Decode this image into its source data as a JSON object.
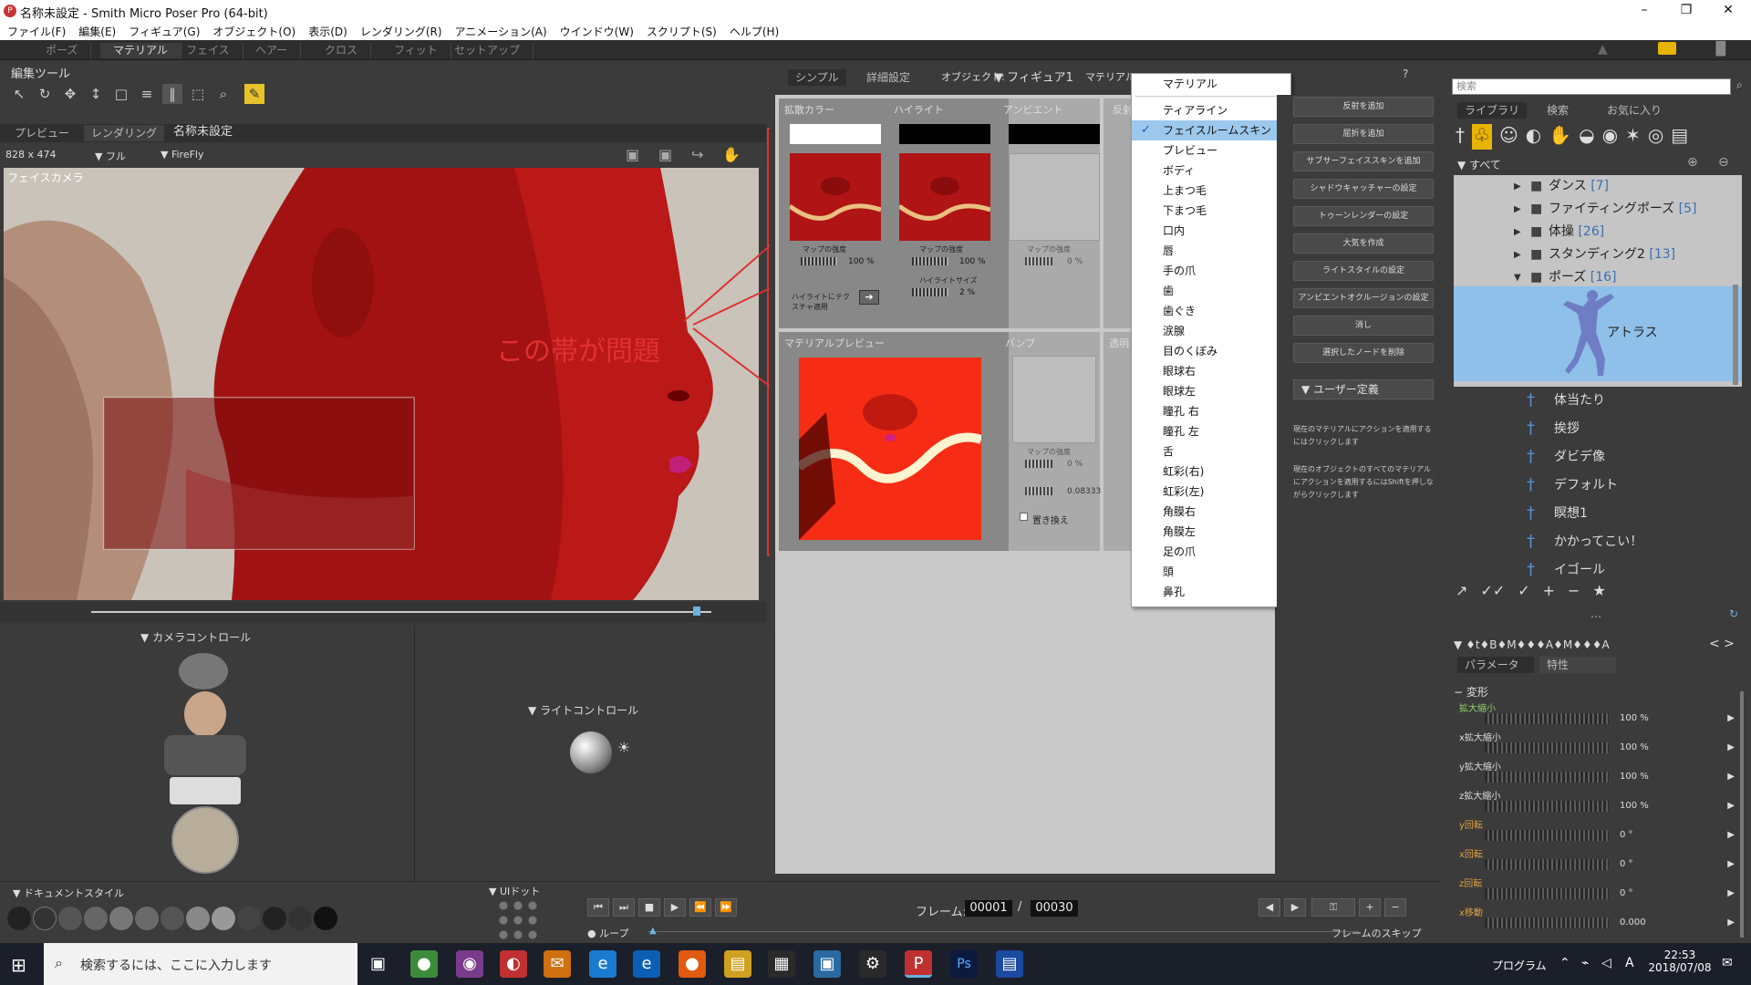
{
  "window": {
    "title": "名称未設定 - Smith Micro Poser Pro  (64-bit)",
    "controls": [
      "minimize-icon",
      "restore-icon",
      "close-icon"
    ]
  },
  "menubar": [
    "ファイル(F)",
    "編集(E)",
    "フィギュア(G)",
    "オブジェクト(O)",
    "表示(D)",
    "レンダリング(R)",
    "アニメーション(A)",
    "ウインドウ(W)",
    "スクリプト(S)",
    "ヘルプ(H)"
  ],
  "modes": [
    "ポーズ",
    "マテリアル",
    "フェイス",
    "ヘアー",
    "クロス",
    "フィット",
    "セットアップ"
  ],
  "active_mode": "マテリアル",
  "edit_tools": {
    "title": "編集ツール"
  },
  "viewport": {
    "tabs": [
      "プレビュー",
      "レンダリング"
    ],
    "doc_title": "名称未設定",
    "size": "828 x 474",
    "display": "フル",
    "renderer": "FireFly",
    "camera": "フェイスカメラ"
  },
  "annotation": {
    "text": "この帯が問題",
    "color": "#e03030"
  },
  "material_room": {
    "tabs": [
      "シンプル",
      "詳細設定"
    ],
    "object_label": "オブジェクト:",
    "object_value": "フィギュア1",
    "material_label": "マテリアル:",
    "columns": {
      "diffuse": "拡散カラー",
      "highlight": "ハイライト",
      "ambient": "アンビエント",
      "reflection": "反射",
      "bump": "バンプ",
      "transparency": "透明"
    },
    "map_strength_label": "マップの強度",
    "diffuse_strength": "100 %",
    "highlight_strength": "100 %",
    "ambient_strength": "0 %",
    "highlight_size_label": "ハイライトサイズ",
    "highlight_size": "2 %",
    "apply_texture": "ハイライトにテクスチャ適用",
    "preview_label": "マテリアルプレビュー",
    "bump_strength": "0 %",
    "bump_amount": "0.08333",
    "replace_label": "置き換え"
  },
  "material_dropdown": {
    "header": "マテリアル",
    "items": [
      "ティアライン",
      "フェイスルームスキン",
      "プレビュー",
      "ボディ",
      "上まつ毛",
      "下まつ毛",
      "口内",
      "唇",
      "手の爪",
      "歯",
      "歯ぐき",
      "涙腺",
      "目のくぼみ",
      "眼球右",
      "眼球左",
      "瞳孔 右",
      "瞳孔 左",
      "舌",
      "虹彩(右)",
      "虹彩(左)",
      "角膜右",
      "角膜左",
      "足の爪",
      "頭",
      "鼻孔"
    ],
    "selected": "フェイスルームスキン"
  },
  "wizards": [
    "反射を追加",
    "屈折を追加",
    "サブサーフェイススキンを追加",
    "シャドウキャッチャーの設定",
    "トゥーンレンダーの設定",
    "大気を作成",
    "ライトスタイルの設定",
    "アンビエントオクルージョンの設定",
    "消し",
    "選択したノードを削除"
  ],
  "user_defined": "ユーザー定義",
  "help_text_1": "現在のマテリアルにアクションを適用するにはクリックします",
  "help_text_2": "現在のオブジェクトのすべてのマテリアルにアクションを適用するにはShiftを押しながらクリックします",
  "camera_control": "カメラコントロール",
  "light_control": "ライトコントロール",
  "document_style": "ドキュメントスタイル",
  "ui_dots": "UIドット",
  "timeline": {
    "frame_label": "フレーム:",
    "current_frame": "00001",
    "total_frames": "00030",
    "loop": "ループ",
    "skip": "フレームのスキップ"
  },
  "library": {
    "search_placeholder": "検索",
    "tabs": [
      "ライブラリ",
      "検索",
      "お気に入り"
    ],
    "root": "すべて",
    "folders": [
      {
        "name": "ダンス",
        "count": "[7]"
      },
      {
        "name": "ファイティングポーズ",
        "count": "[5]"
      },
      {
        "name": "体操",
        "count": "[26]"
      },
      {
        "name": "スタンディング2",
        "count": "[13]"
      },
      {
        "name": "ポーズ",
        "count": "[16]"
      }
    ],
    "selected_item": "アトラス",
    "items": [
      "体当たり",
      "挨拶",
      "ダビデ像",
      "デフォルト",
      "瞑想1",
      "かかってこい！",
      "イゴール"
    ]
  },
  "parameters": {
    "header": "♦t♦B♦M♦♦♦A♦M♦♦♦A",
    "tabs": [
      "パラメータ",
      "特性"
    ],
    "group": "変形",
    "rows": [
      {
        "label": "拡大縮小",
        "value": "100 %",
        "style": "green"
      },
      {
        "label": "x拡大縮小",
        "value": "100 %",
        "style": "normal"
      },
      {
        "label": "y拡大縮小",
        "value": "100 %",
        "style": "normal"
      },
      {
        "label": "z拡大縮小",
        "value": "100 %",
        "style": "normal"
      },
      {
        "label": "y回転",
        "value": "0 °",
        "style": "orange"
      },
      {
        "label": "x回転",
        "value": "0 °",
        "style": "orange"
      },
      {
        "label": "z回転",
        "value": "0 °",
        "style": "orange"
      },
      {
        "label": "x移動",
        "value": "0.000",
        "style": "orange"
      }
    ]
  },
  "taskbar": {
    "search_placeholder": "検索するには、ここに入力します",
    "program_label": "プログラム",
    "ime": "A",
    "time": "22:53",
    "date": "2018/07/08"
  }
}
